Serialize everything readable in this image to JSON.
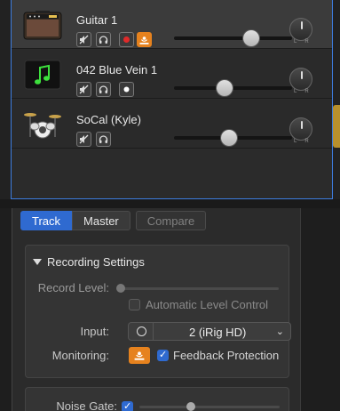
{
  "tracks": [
    {
      "name": "Guitar 1",
      "thumb": "amp-icon",
      "selected": true,
      "volume": 0.78,
      "record_enabled": true,
      "monitoring_on": true
    },
    {
      "name": "042 Blue Vein 1",
      "thumb": "music-note-icon",
      "selected": false,
      "volume": 0.4,
      "record_enabled": true,
      "monitoring_on": false
    },
    {
      "name": "SoCal (Kyle)",
      "thumb": "drum-kit-icon",
      "selected": false,
      "volume": 0.45,
      "record_enabled": false,
      "monitoring_on": false
    }
  ],
  "pan": {
    "left_label": "L",
    "right_label": "R"
  },
  "tabs": {
    "track": "Track",
    "master": "Master",
    "compare": "Compare"
  },
  "recording": {
    "title": "Recording Settings",
    "record_level_label": "Record Level:",
    "auto_level_label": "Automatic Level Control",
    "auto_level_checked": false,
    "input_label": "Input:",
    "input_value": "2  (iRig HD)",
    "monitoring_label": "Monitoring:",
    "feedback_label": "Feedback Protection",
    "feedback_checked": true
  },
  "noise_gate": {
    "label": "Noise Gate:",
    "checked": true
  },
  "colors": {
    "accent": "#2f6ad0",
    "orange": "#e6821e",
    "record_red": "#e02a2a"
  }
}
